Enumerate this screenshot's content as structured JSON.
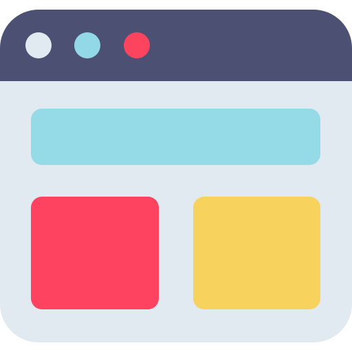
{
  "icon": {
    "name": "browser-window-icon",
    "colors": {
      "title_bar": "#4c5072",
      "window_body": "#e2eaf1",
      "dot_1": "#e2eaf1",
      "dot_2": "#93d8e6",
      "dot_3": "#fd445f",
      "banner": "#95dbe7",
      "card_left": "#fd435f",
      "card_right": "#f7d25c"
    }
  }
}
